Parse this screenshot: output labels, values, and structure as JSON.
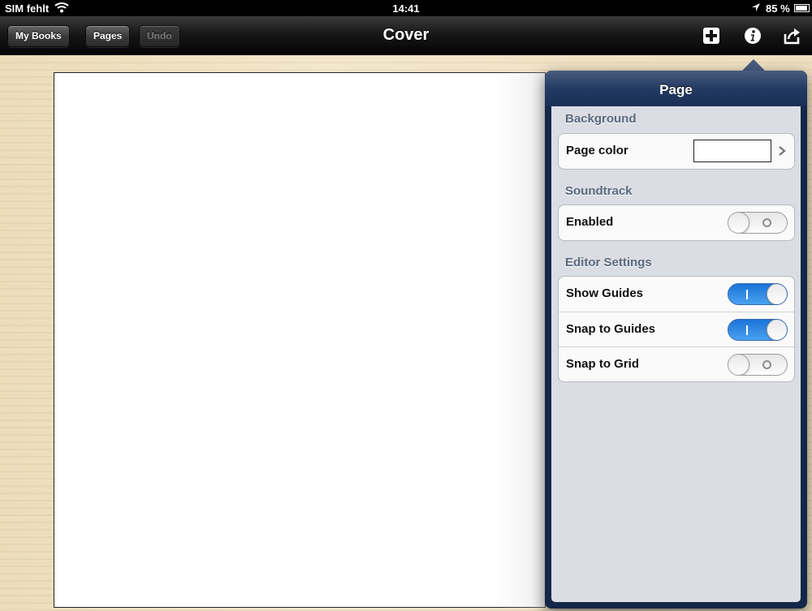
{
  "status_bar": {
    "carrier": "SIM fehlt",
    "time": "14:41",
    "battery": "85 %"
  },
  "nav_bar": {
    "my_books": "My Books",
    "pages": "Pages",
    "undo": "Undo",
    "title": "Cover",
    "icons": [
      "add-icon",
      "info-icon",
      "share-icon"
    ]
  },
  "popover": {
    "title": "Page",
    "background_header": "Background",
    "page_color_label": "Page color",
    "page_color_value": "#ffffff",
    "soundtrack_header": "Soundtrack",
    "enabled_label": "Enabled",
    "enabled": false,
    "editor_settings_header": "Editor Settings",
    "show_guides_label": "Show Guides",
    "show_guides": true,
    "snap_to_guides_label": "Snap to Guides",
    "snap_to_guides": true,
    "snap_to_grid_label": "Snap to Grid",
    "snap_to_grid": false
  },
  "colors": {
    "nav_background": "#151515",
    "popover_frame": "#142746",
    "switch_on": "#2c86e6"
  }
}
